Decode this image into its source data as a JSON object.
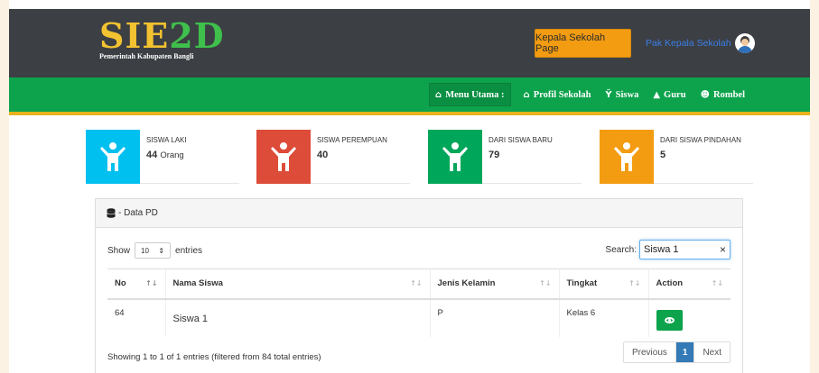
{
  "header": {
    "logo_part1": "SIE",
    "logo_part2": "2D",
    "logo_subtitle": "Pemerintah Kabupaten Bangli",
    "kepala_button": "Kepala Sekolah Page",
    "user_name": "Pak Kepala Sekolah"
  },
  "nav": {
    "menu_label": "Menu Utama :",
    "items": [
      {
        "label": "Profil Sekolah",
        "icon": "building-icon"
      },
      {
        "label": "Siswa",
        "icon": "child-icon"
      },
      {
        "label": "Guru",
        "icon": "graduation-cap-icon"
      },
      {
        "label": "Rombel",
        "icon": "users-icon"
      }
    ]
  },
  "stats": [
    {
      "label": "SISWA LAKI",
      "value": "44",
      "unit": "Orang",
      "color": "#00c0ef"
    },
    {
      "label": "SISWA PEREMPUAN",
      "value": "40",
      "unit": "",
      "color": "#dd4b39"
    },
    {
      "label": "DARI SISWA BARU",
      "value": "79",
      "unit": "",
      "color": "#00a65a"
    },
    {
      "label": "DARI SISWA PINDAHAN",
      "value": "5",
      "unit": "",
      "color": "#f39c12"
    }
  ],
  "panel": {
    "title": "- Data PD",
    "show_label": "Show",
    "entries_value": "10",
    "entries_label": "entries",
    "search_label": "Search:",
    "search_value": "Siswa 1",
    "columns": [
      "No",
      "Nama Siswa",
      "Jenis Kelamin",
      "Tingkat",
      "Action"
    ],
    "rows": [
      {
        "no": "64",
        "nama": "Siswa 1",
        "jk": "P",
        "tingkat": "Kelas 6"
      }
    ],
    "info": "Showing 1 to 1 of 1 entries (filtered from 84 total entries)",
    "pager": {
      "prev": "Previous",
      "current": "1",
      "next": "Next"
    }
  }
}
